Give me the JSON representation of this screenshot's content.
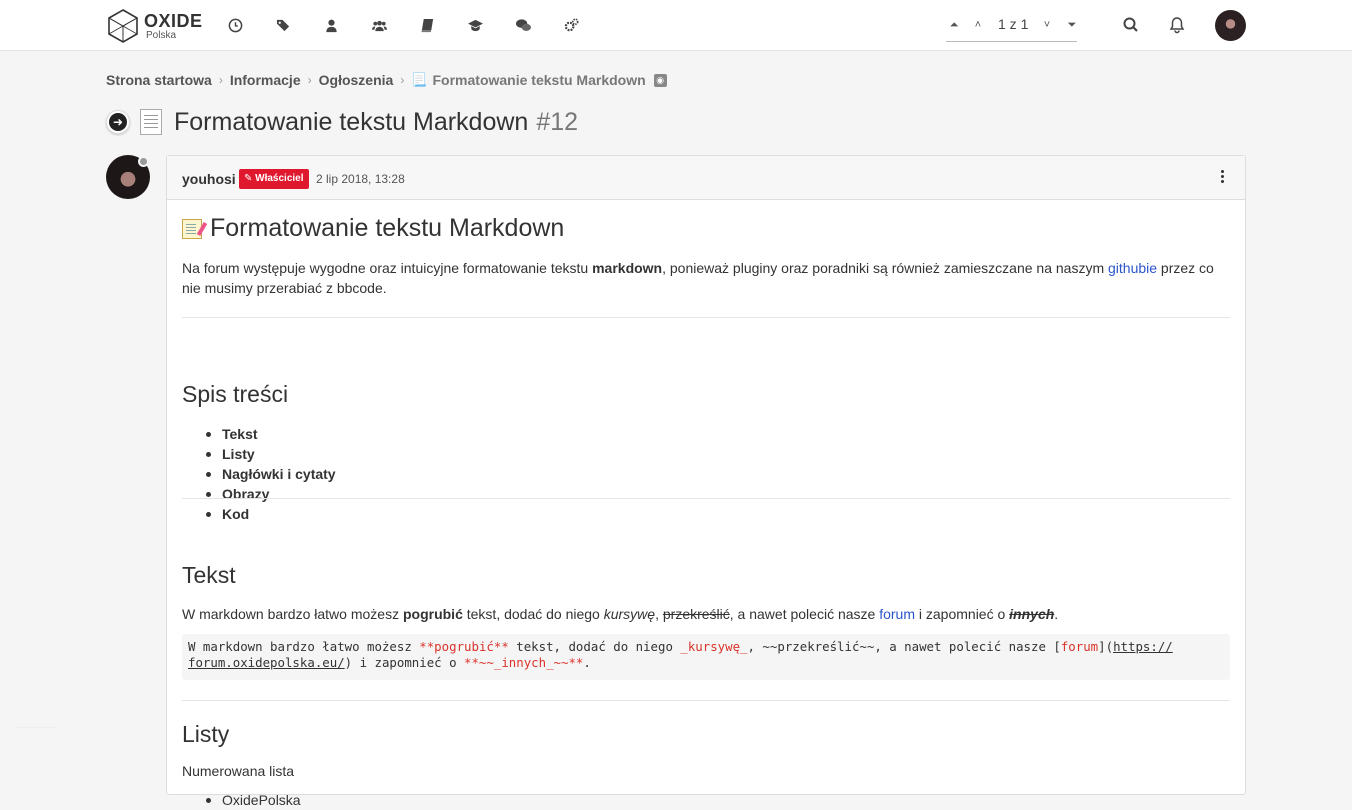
{
  "header": {
    "logo_title": "OXIDE",
    "logo_sub": "Polska",
    "nav_icons": [
      "clock-icon",
      "tags-icon",
      "user-icon",
      "users-icon",
      "book-icon",
      "graduation-cap-icon",
      "wechat-icon",
      "cogs-icon"
    ],
    "pager": {
      "text": "1 z 1"
    }
  },
  "breadcrumb": {
    "items": [
      "Strona startowa",
      "Informacje",
      "Ogłoszenia"
    ],
    "current": "Formatowanie tekstu Markdown"
  },
  "topic": {
    "title": "Formatowanie tekstu Markdown",
    "number": "#12"
  },
  "post": {
    "author": "youhosi",
    "badge": "✎ Właściciel",
    "date": "2 lip 2018, 13:28",
    "heading": "Formatowanie tekstu Markdown",
    "intro": {
      "t1": "Na forum występuje wygodne oraz intuicyjne formatowanie tekstu ",
      "b1": "markdown",
      "t2": ", ponieważ pluginy oraz poradniki są również zamieszczane na naszym ",
      "link": "githubie",
      "t3": " przez co nie musimy przerabiać z bbcode."
    },
    "toc_heading": "Spis treści",
    "toc": [
      "Tekst",
      "Listy",
      "Nagłówki i cytaty",
      "Obrazy",
      "Kod"
    ],
    "tekst_heading": "Tekst",
    "tekst": {
      "t1": "W markdown bardzo łatwo możesz ",
      "bold": "pogrubić",
      "t2": " tekst, dodać do niego ",
      "italic": "kursywę",
      "t3": ", ",
      "strike": "przekreślić",
      "t4": ", a nawet polecić nasze ",
      "link": "forum",
      "t5": " i zapomnieć o ",
      "combo": "innych",
      "t6": "."
    },
    "code": {
      "c1": "W markdown bardzo łatwo możesz ",
      "c2": "**pogrubić**",
      "c3": " tekst, dodać do niego ",
      "c4": "_kursywę_",
      "c5": ", ~~przekreślić~~, a nawet polecić nasze [",
      "c6": "forum",
      "c7": "](",
      "c8a": "https://",
      "c8b": "forum.oxidepolska.eu/",
      "c9": ") i zapomnieć o ",
      "c10": "**~~_innych_~~**",
      "c11": "."
    },
    "listy_heading": "Listy",
    "listy_sub": "Numerowana lista",
    "listy_items": [
      "OxidePolska"
    ]
  }
}
